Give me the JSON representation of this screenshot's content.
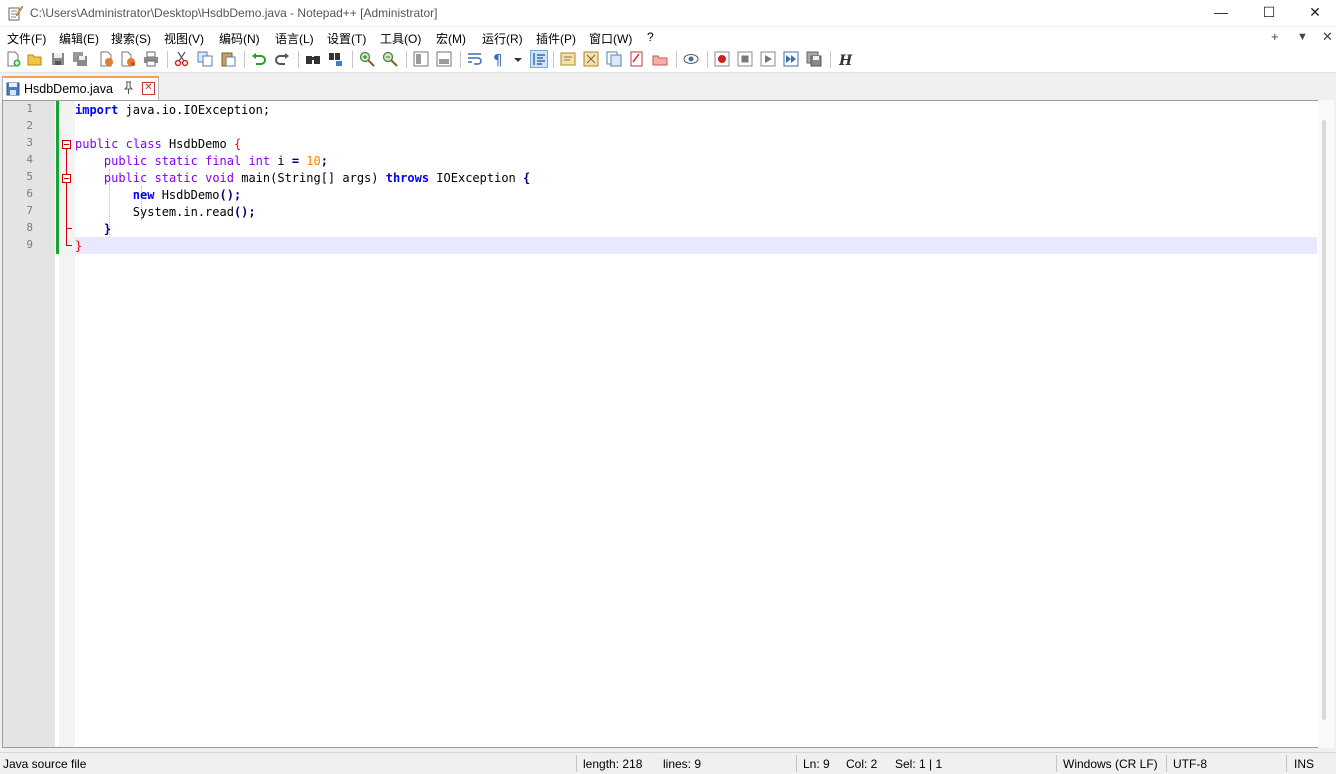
{
  "window": {
    "title": "C:\\Users\\Administrator\\Desktop\\HsdbDemo.java - Notepad++ [Administrator]",
    "controls": [
      "—",
      "☐",
      "✕"
    ]
  },
  "menu": {
    "items": [
      "文件(F)",
      "编辑(E)",
      "搜索(S)",
      "视图(V)",
      "编码(N)",
      "语言(L)",
      "设置(T)",
      "工具(O)",
      "宏(M)",
      "运行(R)",
      "插件(P)",
      "窗口(W)",
      "?"
    ],
    "right_controls": [
      "+",
      "▼",
      "✕"
    ]
  },
  "toolbar": {
    "icons": [
      "new-file-icon",
      "open-file-icon",
      "save-icon",
      "save-all-icon",
      "close-icon",
      "close-all-icon",
      "print-icon",
      "cut-icon",
      "copy-icon",
      "paste-icon",
      "undo-icon",
      "redo-icon",
      "find-icon",
      "replace-icon",
      "zoom-in-icon",
      "zoom-out-icon",
      "sync-vertical-icon",
      "sync-horizontal-icon",
      "word-wrap-icon",
      "show-all-chars-icon",
      "indent-guide-icon",
      "function-list-icon",
      "doc-map-icon",
      "doc-list-icon",
      "folder-workspace-icon",
      "monitoring-icon",
      "record-macro-icon",
      "stop-record-icon",
      "play-macro-icon",
      "run-macro-multiple-icon",
      "save-macro-icon",
      "hex-icon"
    ]
  },
  "tab": {
    "label": "HsdbDemo.java",
    "pin": "📌",
    "close": "✕"
  },
  "editor": {
    "line_numbers": [
      "1",
      "2",
      "3",
      "4",
      "5",
      "6",
      "7",
      "8",
      "9"
    ],
    "lines": [
      [
        [
          "kw",
          "import"
        ],
        [
          "n",
          " java.io.IOException;"
        ]
      ],
      [],
      [
        [
          "kw2",
          "public"
        ],
        [
          "n",
          " "
        ],
        [
          "kw2",
          "class"
        ],
        [
          "n",
          " HsdbDemo "
        ],
        [
          "red",
          "{"
        ]
      ],
      [
        [
          "n",
          "    "
        ],
        [
          "kw2",
          "public"
        ],
        [
          "n",
          " "
        ],
        [
          "kw2",
          "static"
        ],
        [
          "n",
          " "
        ],
        [
          "kw2",
          "final"
        ],
        [
          "n",
          " "
        ],
        [
          "kw2",
          "int"
        ],
        [
          "n",
          " i "
        ],
        [
          "op",
          "="
        ],
        [
          "n",
          " "
        ],
        [
          "num",
          "10"
        ],
        [
          "op",
          ";"
        ]
      ],
      [
        [
          "n",
          "    "
        ],
        [
          "kw2",
          "public"
        ],
        [
          "n",
          " "
        ],
        [
          "kw2",
          "static"
        ],
        [
          "n",
          " "
        ],
        [
          "kw2",
          "void"
        ],
        [
          "n",
          " main(String[] args) "
        ],
        [
          "kw",
          "throws"
        ],
        [
          "n",
          " IOException "
        ],
        [
          "op",
          "{"
        ]
      ],
      [
        [
          "n",
          "        "
        ],
        [
          "kw",
          "new"
        ],
        [
          "n",
          " HsdbDemo"
        ],
        [
          "op",
          "();"
        ]
      ],
      [
        [
          "n",
          "        System.in.read"
        ],
        [
          "op",
          "();"
        ]
      ],
      [
        [
          "n",
          "    "
        ],
        [
          "op",
          "}"
        ]
      ],
      [
        [
          "red",
          "}"
        ]
      ]
    ]
  },
  "status": {
    "file_type": "Java source file",
    "length": "length: 218",
    "lines": "lines: 9",
    "ln": "Ln: 9",
    "col": "Col: 2",
    "sel": "Sel: 1 | 1",
    "eol": "Windows (CR LF)",
    "encoding": "UTF-8",
    "mode": "INS"
  }
}
